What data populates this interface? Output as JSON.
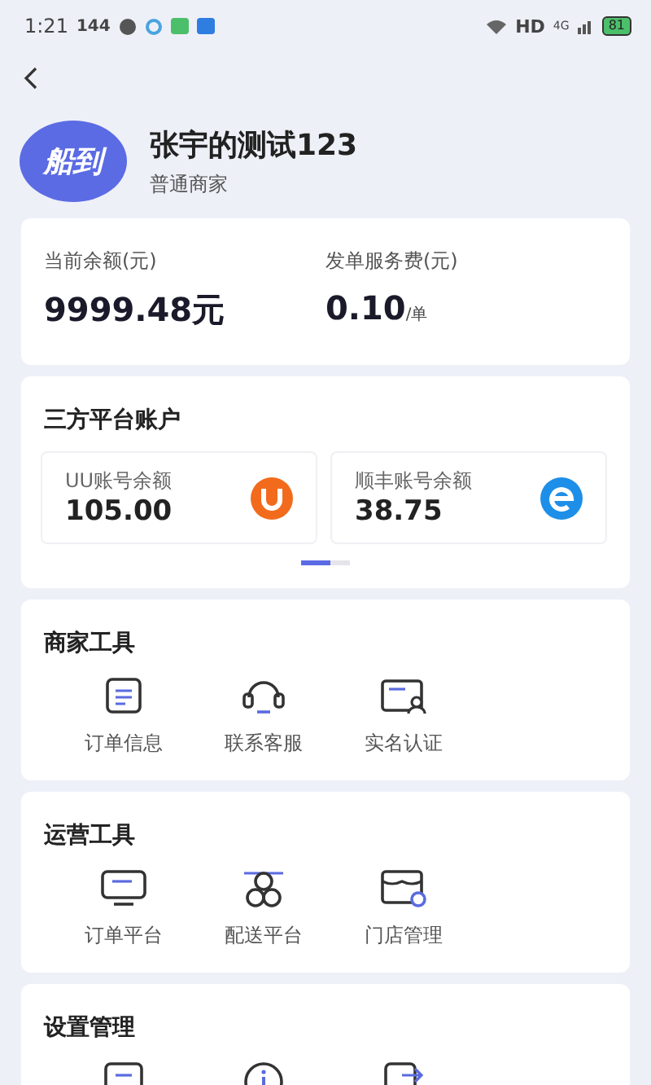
{
  "status_bar": {
    "time": "1:21",
    "speed": "144",
    "network": "HD",
    "signal_type": "4G",
    "battery": "81"
  },
  "header": {
    "avatar_text": "船到",
    "name": "张宇的测试123",
    "role": "普通商家"
  },
  "balance_card": {
    "items": [
      {
        "label": "当前余额(元)",
        "value": "9999.48元"
      },
      {
        "label": "发单服务费(元)",
        "value": "0.10",
        "unit": "/单"
      }
    ]
  },
  "platform_accounts": {
    "title": "三方平台账户",
    "accounts": [
      {
        "label": "UU账号余额",
        "value": "105.00"
      },
      {
        "label": "顺丰账号余额",
        "value": "38.75"
      }
    ],
    "pages": [
      {
        "selected": true
      },
      {
        "selected": false
      }
    ]
  },
  "sections": [
    {
      "title": "商家工具",
      "items": [
        {
          "label": "订单信息"
        },
        {
          "label": "联系客服"
        },
        {
          "label": "实名认证"
        }
      ]
    },
    {
      "title": "运营工具",
      "items": [
        {
          "label": "订单平台"
        },
        {
          "label": "配送平台"
        },
        {
          "label": "门店管理"
        }
      ]
    },
    {
      "title": "设置管理"
    }
  ]
}
